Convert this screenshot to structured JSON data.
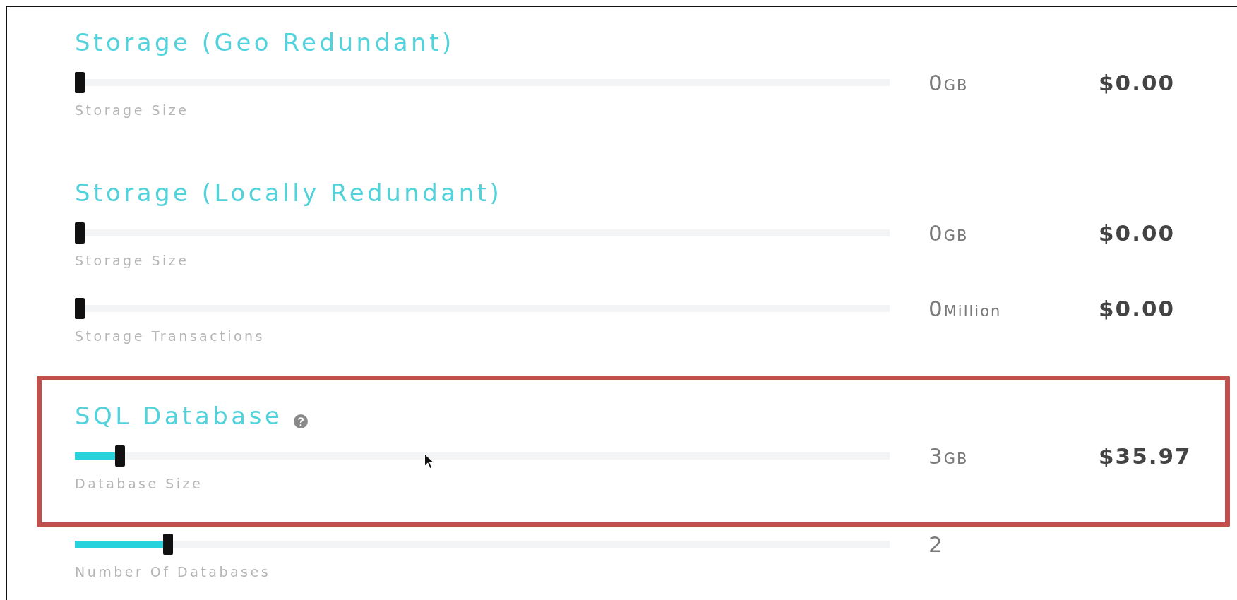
{
  "sections": [
    {
      "title": "Storage (Geo Redundant)",
      "help": false,
      "highlighted": false,
      "sliders": [
        {
          "label": "Storage Size",
          "level": 0,
          "value": "0",
          "unit": "GB",
          "price": "$0.00"
        }
      ]
    },
    {
      "title": "Storage (Locally Redundant)",
      "help": false,
      "highlighted": false,
      "sliders": [
        {
          "label": "Storage Size",
          "level": 0,
          "value": "0",
          "unit": "GB",
          "price": "$0.00"
        },
        {
          "label": "Storage Transactions",
          "level": 0,
          "value": "0",
          "unit": "Million",
          "price": "$0.00"
        }
      ]
    },
    {
      "title": "SQL Database",
      "help": true,
      "highlighted": true,
      "sliders": [
        {
          "label": "Database Size",
          "level": 0.05,
          "value": "3",
          "unit": "GB",
          "price": "$35.97"
        },
        {
          "label": "Number Of Databases",
          "level": 0.11,
          "value": "2"
        }
      ]
    }
  ]
}
